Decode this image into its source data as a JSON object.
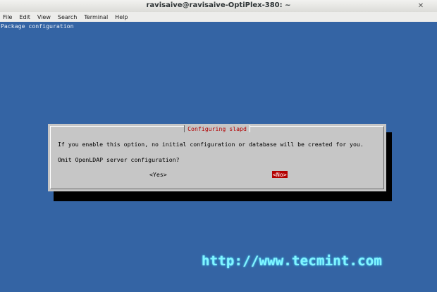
{
  "window": {
    "title": "ravisaive@ravisaive-OptiPlex-380: ~",
    "close_glyph": "✕"
  },
  "menu": [
    "File",
    "Edit",
    "View",
    "Search",
    "Terminal",
    "Help"
  ],
  "terminal": {
    "header": "Package configuration",
    "background_color": "#3464a4"
  },
  "dialog": {
    "title": "Configuring slapd",
    "message": "If you enable this option, no initial configuration or database will be created for you.",
    "question": "Omit OpenLDAP server configuration?",
    "yes_label": "<Yes>",
    "no_label": "<No>",
    "selected": "no",
    "accent_color": "#b30000"
  },
  "watermark": "http://www.tecmint.com"
}
